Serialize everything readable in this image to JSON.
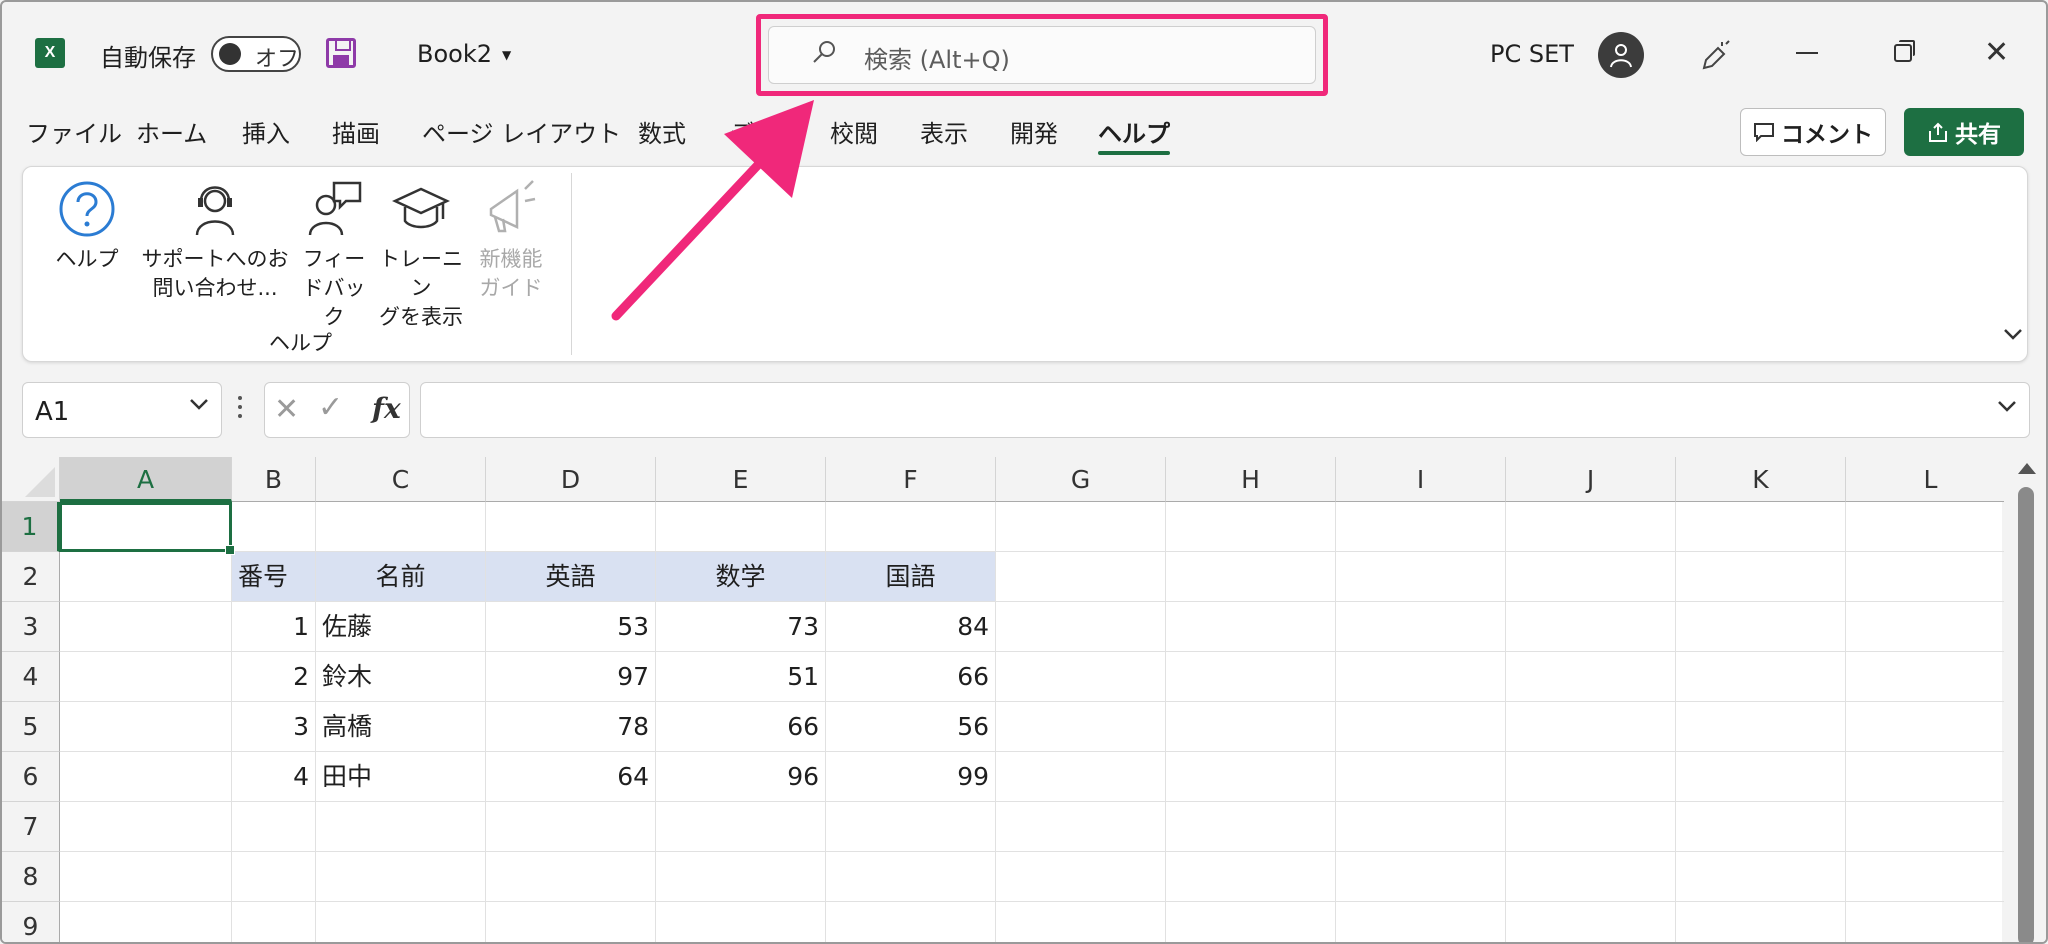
{
  "titlebar": {
    "autosave_label": "自動保存",
    "autosave_toggle": "オフ",
    "book_title": "Book2",
    "search_placeholder": "検索 (Alt+Q)",
    "account_name": "PC SET"
  },
  "menu": {
    "tabs": [
      {
        "label": "ファイル"
      },
      {
        "label": "ホーム"
      },
      {
        "label": "挿入"
      },
      {
        "label": "描画"
      },
      {
        "label": "ページ レイアウト"
      },
      {
        "label": "数式"
      },
      {
        "label": "デ"
      },
      {
        "label": "校閲"
      },
      {
        "label": "表示"
      },
      {
        "label": "開発"
      },
      {
        "label": "ヘルプ"
      }
    ],
    "active_tab": "ヘルプ",
    "comment_label": "コメント",
    "share_label": "共有"
  },
  "ribbon": {
    "buttons": [
      {
        "line1": "ヘルプ",
        "line2": ""
      },
      {
        "line1": "サポートへのお",
        "line2": "問い合わせ..."
      },
      {
        "line1": "フィー",
        "line2": "ドバック"
      },
      {
        "line1": "トレーニン",
        "line2": "グを表示"
      },
      {
        "line1": "新機能",
        "line2": "ガイド"
      }
    ],
    "group_label": "ヘルプ"
  },
  "formula_bar": {
    "name_box": "A1",
    "fx_label": "fx",
    "formula": ""
  },
  "sheet": {
    "columns": [
      "A",
      "B",
      "C",
      "D",
      "E",
      "F",
      "G",
      "H",
      "I",
      "J",
      "K",
      "L"
    ],
    "rows": [
      "1",
      "2",
      "3",
      "4",
      "5",
      "6",
      "7",
      "8",
      "9"
    ],
    "selected_cell": "A1",
    "table_headers": [
      "番号",
      "名前",
      "英語",
      "数学",
      "国語"
    ],
    "table_rows": [
      [
        "1",
        "佐藤",
        "53",
        "73",
        "84"
      ],
      [
        "2",
        "鈴木",
        "97",
        "51",
        "66"
      ],
      [
        "3",
        "高橋",
        "78",
        "66",
        "56"
      ],
      [
        "4",
        "田中",
        "64",
        "96",
        "99"
      ]
    ]
  },
  "colors": {
    "accent_green": "#1d6f42",
    "annotation_pink": "#f0287a",
    "table_header_fill": "#d9e1f2"
  }
}
